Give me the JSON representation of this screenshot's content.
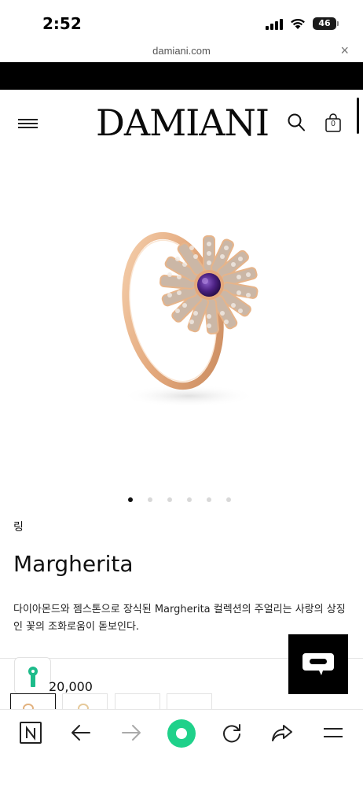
{
  "status_bar": {
    "time": "2:52",
    "battery": "46"
  },
  "browser": {
    "url": "damiani.com",
    "close": "×"
  },
  "header": {
    "brand": "DAMIANI",
    "cart_count": "0"
  },
  "product": {
    "category": "링",
    "name": "Margherita",
    "description": "다이아몬드와 젬스톤으로 장식된 Margherita 컬렉션의 주얼리는 사랑의 상징인 꽃의 조화로움이 돋보인다.",
    "price_visible": "20,000",
    "gallery_pages": 6,
    "gallery_active_index": 0
  },
  "colors": {
    "accent_green": "#1fd18a",
    "lock_green": "#1dbb8a",
    "gold": "#e7b58a",
    "amethyst": "#5a2a8a"
  },
  "icons": [
    "menu-icon",
    "search-icon",
    "bag-icon",
    "lock-icon",
    "chat-icon",
    "n-icon",
    "back-icon",
    "forward-icon",
    "home-icon",
    "reload-icon",
    "share-icon",
    "browser-menu-icon"
  ]
}
